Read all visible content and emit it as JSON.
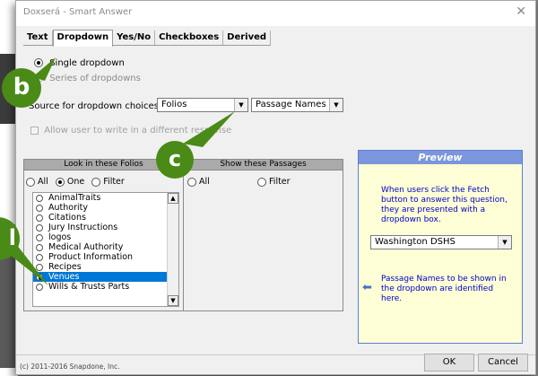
{
  "window": {
    "title": "Doxserá - Smart Answer",
    "close_glyph": "✕"
  },
  "tabs": [
    "Text",
    "Dropdown",
    "Yes/No",
    "Checkboxes",
    "Derived"
  ],
  "options": {
    "single_dropdown": "Single dropdown",
    "series_of_dropdowns": "Series of dropdowns"
  },
  "source": {
    "label": "Source for dropdown choices:",
    "folios_value": "Folios",
    "passage_value": "Passage Names"
  },
  "allow_write": "Allow user to write in a different response",
  "look_in": {
    "header": "Look in these Folios",
    "all": "All",
    "one": "One",
    "filter": "Filter",
    "items": [
      "AnimalTraits",
      "Authority",
      "Citations",
      "Jury Instructions",
      "logos",
      "Medical Authority",
      "Product Information",
      "Recipes",
      "Venues",
      "Wills & Trusts Parts"
    ],
    "selected": "Venues"
  },
  "show_passages": {
    "header": "Show these Passages",
    "all": "All",
    "filter": "Filter"
  },
  "preview": {
    "title": "Preview",
    "text": "When users click the Fetch button to answer this question, they are presented with a dropdown box.",
    "dropdown_value": "Washington DSHS",
    "note": "Passage Names to be shown in the dropdown are identified here."
  },
  "footer": {
    "copyright": "(c) 2011-2016 Snapdone, Inc.",
    "ok": "OK",
    "cancel": "Cancel"
  },
  "callouts": {
    "b": "b",
    "c": "c",
    "partial": "l"
  },
  "colors": {
    "callout": "#4a8a16",
    "selection": "#0078d7",
    "preview_header": "#7b96dc",
    "preview_bg": "#fefed6"
  }
}
